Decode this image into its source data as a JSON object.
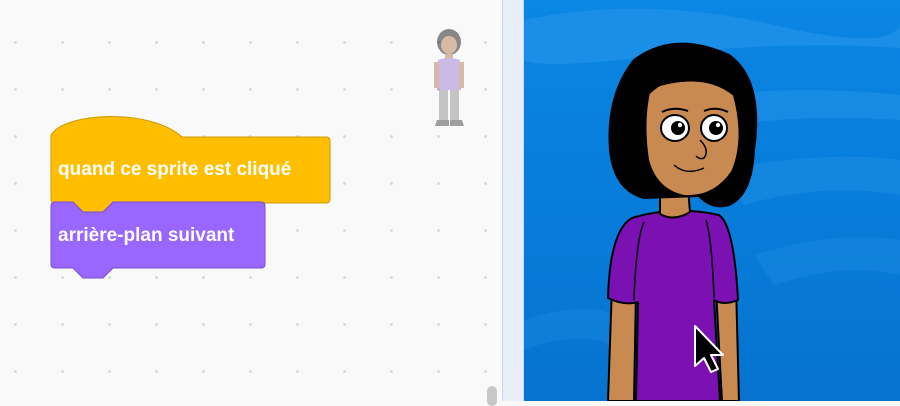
{
  "blocks": {
    "event_hat": {
      "label": "quand ce sprite est cliqué",
      "color": "#ffbf00",
      "border": "#cc9900"
    },
    "looks_stack": {
      "label": "arrière-plan suivant",
      "color": "#9966ff",
      "border": "#774dcb"
    }
  },
  "icons": {
    "sprite_thumbnail": "sprite-ghost-icon",
    "cursor": "mouse-pointer-icon"
  },
  "colors": {
    "stage_bg": "#0a7fdc",
    "skin": "#c98a52",
    "hair": "#000000",
    "shirt": "#7b10b3"
  }
}
